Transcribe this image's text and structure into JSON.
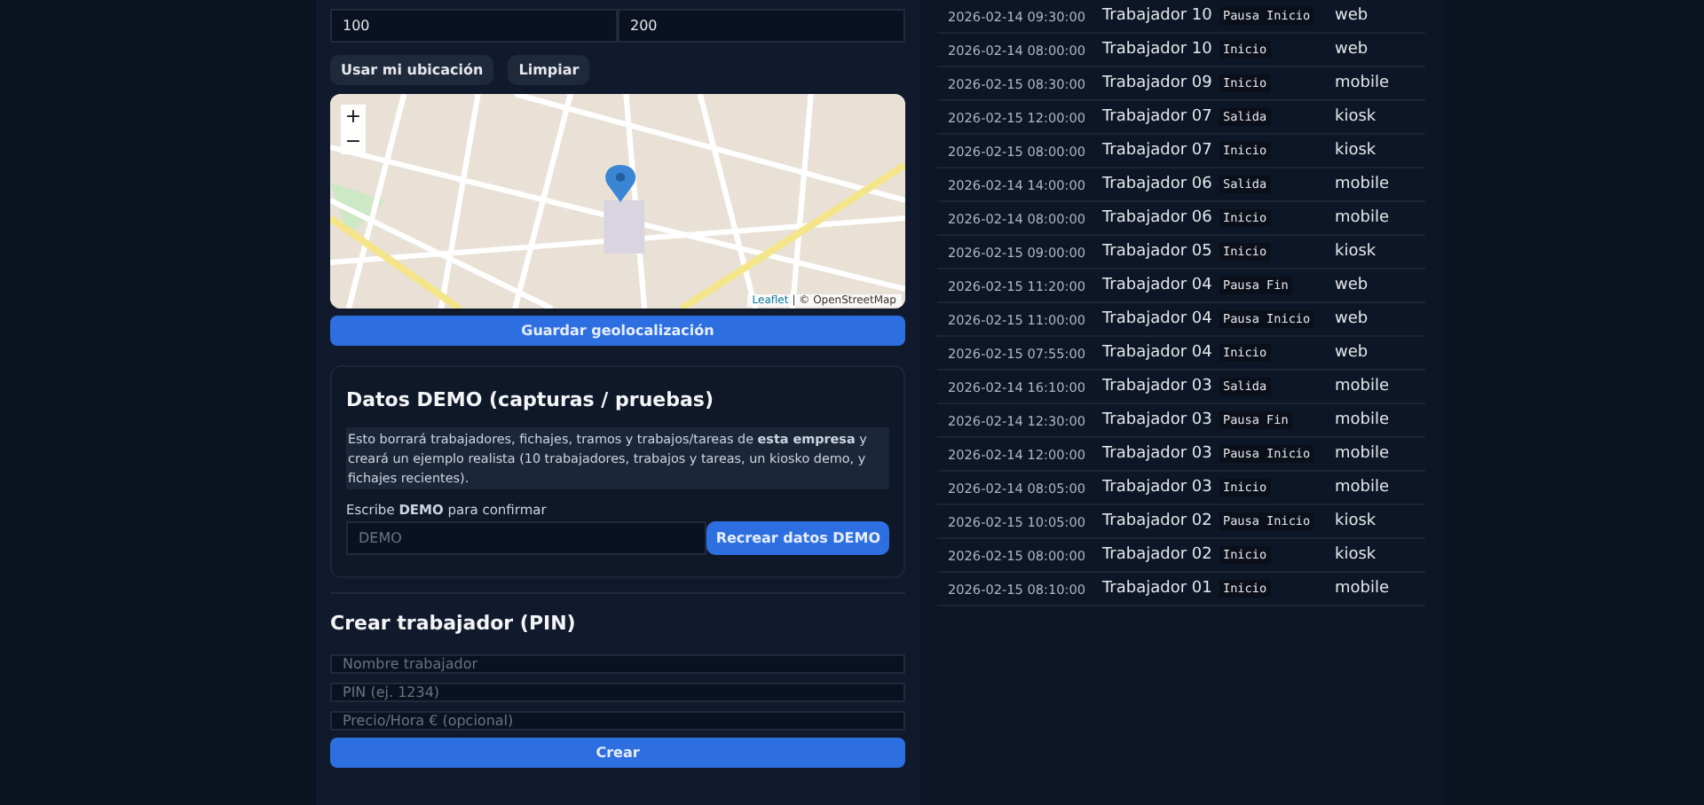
{
  "location_form": {
    "fields": [
      {
        "value": "100"
      },
      {
        "value": "200"
      }
    ],
    "buttons": [
      "Usar mi ubicación",
      "Limpiar"
    ],
    "map": {
      "zoom_in": "+",
      "zoom_out": "−",
      "attribution_link": "Leaflet",
      "attribution": "| © OpenStreetMap"
    },
    "save_button": "Guardar geolocalización"
  },
  "demo": {
    "title": "Datos DEMO (capturas / pruebas)",
    "warning": "Esto borrará trabajadores, fichajes, tramos y trabajos/tareas de **esta empresa** y creará un ejemplo realista (10 trabajadores, trabajos y tareas, un kiosko demo, y fichajes recientes).",
    "confirm_label": "Escribe **DEMO** para confirmar",
    "confirm_placeholder": "DEMO",
    "button": "Recrear datos DEMO"
  },
  "create_worker": {
    "title": "Crear trabajador (PIN)",
    "fields": [
      {
        "placeholder": "Nombre trabajador"
      },
      {
        "placeholder": "PIN (ej. 1234)"
      },
      {
        "placeholder": "Precio/Hora € (opcional)"
      }
    ],
    "button": "Crear"
  },
  "punches": [
    {
      "time": "2026-02-14 09:30:00",
      "worker": "Trabajador 10",
      "type": "Pausa Inicio",
      "source": "web"
    },
    {
      "time": "2026-02-14 08:00:00",
      "worker": "Trabajador 10",
      "type": "Inicio",
      "source": "web"
    },
    {
      "time": "2026-02-15 08:30:00",
      "worker": "Trabajador 09",
      "type": "Inicio",
      "source": "mobile"
    },
    {
      "time": "2026-02-15 12:00:00",
      "worker": "Trabajador 07",
      "type": "Salida",
      "source": "kiosk"
    },
    {
      "time": "2026-02-15 08:00:00",
      "worker": "Trabajador 07",
      "type": "Inicio",
      "source": "kiosk"
    },
    {
      "time": "2026-02-14 14:00:00",
      "worker": "Trabajador 06",
      "type": "Salida",
      "source": "mobile"
    },
    {
      "time": "2026-02-14 08:00:00",
      "worker": "Trabajador 06",
      "type": "Inicio",
      "source": "mobile"
    },
    {
      "time": "2026-02-15 09:00:00",
      "worker": "Trabajador 05",
      "type": "Inicio",
      "source": "kiosk"
    },
    {
      "time": "2026-02-15 11:20:00",
      "worker": "Trabajador 04",
      "type": "Pausa Fin",
      "source": "web"
    },
    {
      "time": "2026-02-15 11:00:00",
      "worker": "Trabajador 04",
      "type": "Pausa Inicio",
      "source": "web"
    },
    {
      "time": "2026-02-15 07:55:00",
      "worker": "Trabajador 04",
      "type": "Inicio",
      "source": "web"
    },
    {
      "time": "2026-02-14 16:10:00",
      "worker": "Trabajador 03",
      "type": "Salida",
      "source": "mobile"
    },
    {
      "time": "2026-02-14 12:30:00",
      "worker": "Trabajador 03",
      "type": "Pausa Fin",
      "source": "mobile"
    },
    {
      "time": "2026-02-14 12:00:00",
      "worker": "Trabajador 03",
      "type": "Pausa Inicio",
      "source": "mobile"
    },
    {
      "time": "2026-02-14 08:05:00",
      "worker": "Trabajador 03",
      "type": "Inicio",
      "source": "mobile"
    },
    {
      "time": "2026-02-15 10:05:00",
      "worker": "Trabajador 02",
      "type": "Pausa Inicio",
      "source": "kiosk"
    },
    {
      "time": "2026-02-15 08:00:00",
      "worker": "Trabajador 02",
      "type": "Inicio",
      "source": "kiosk"
    },
    {
      "time": "2026-02-15 08:10:00",
      "worker": "Trabajador 01",
      "type": "Inicio",
      "source": "mobile"
    }
  ]
}
